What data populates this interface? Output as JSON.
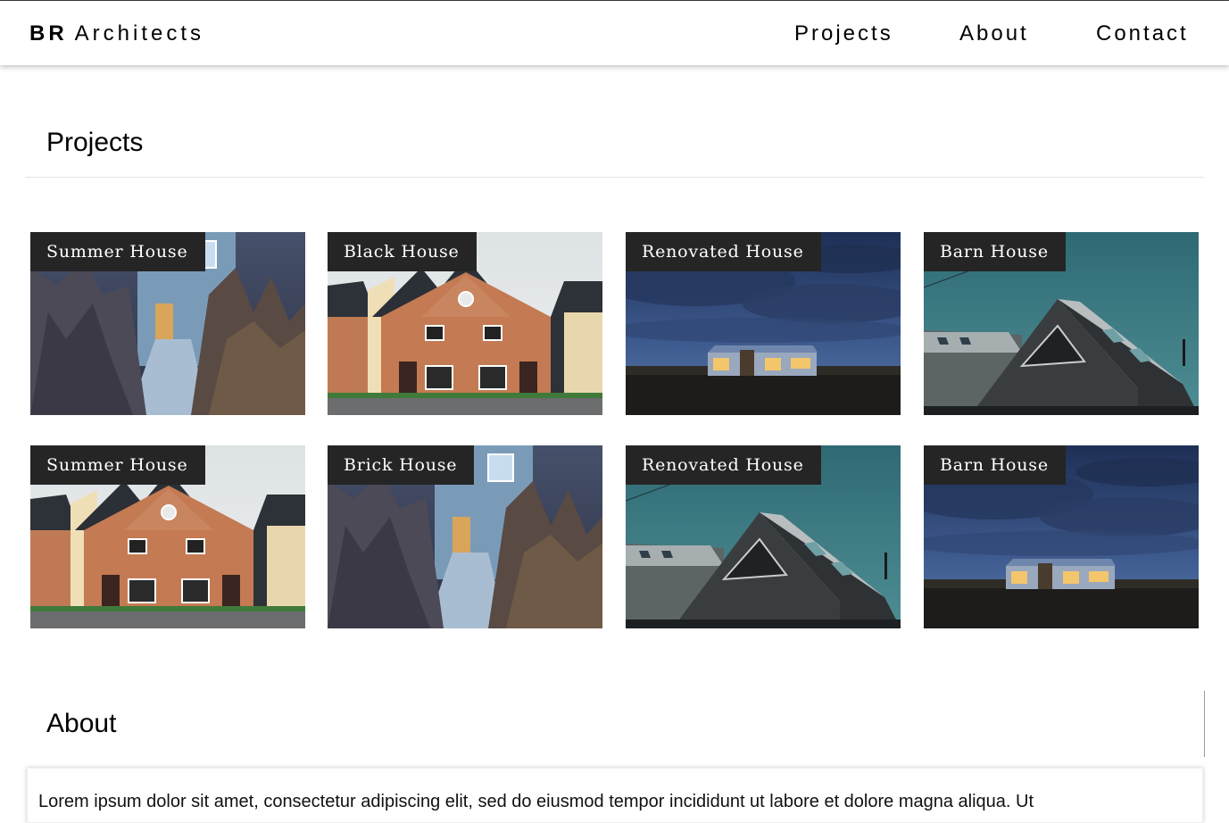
{
  "brand": {
    "initials": "BR",
    "name": "Architects"
  },
  "nav": {
    "items": [
      {
        "label": "Projects"
      },
      {
        "label": "About"
      },
      {
        "label": "Contact"
      }
    ]
  },
  "projects": {
    "title": "Projects",
    "items": [
      {
        "label": "Summer House",
        "image": "walkway-house-dusk"
      },
      {
        "label": "Black House",
        "image": "brick-houses-row"
      },
      {
        "label": "Renovated House",
        "image": "bungalow-night-sky"
      },
      {
        "label": "Barn House",
        "image": "dark-barn-roof"
      },
      {
        "label": "Summer House",
        "image": "brick-houses-row"
      },
      {
        "label": "Brick House",
        "image": "walkway-house-dusk"
      },
      {
        "label": "Renovated House",
        "image": "dark-barn-roof"
      },
      {
        "label": "Barn House",
        "image": "bungalow-night-sky"
      }
    ]
  },
  "about": {
    "title": "About",
    "text": "Lorem ipsum dolor sit amet, consectetur adipiscing elit, sed do eiusmod tempor incididunt ut labore et dolore magna aliqua. Ut"
  }
}
